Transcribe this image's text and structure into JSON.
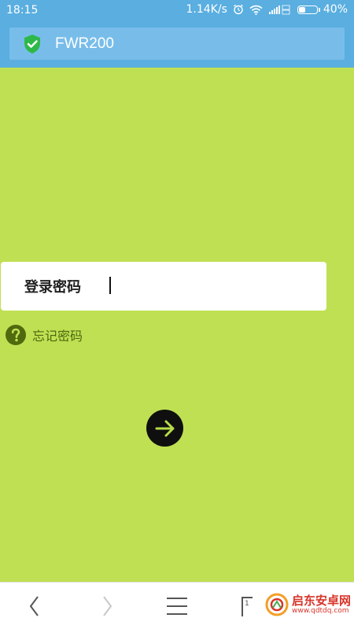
{
  "status_bar": {
    "time": "18:15",
    "network_speed": "1.14K/s",
    "battery_percent": "40%",
    "battery_level": 0.4,
    "icons": [
      "alarm-icon",
      "wifi-icon",
      "signal-icon",
      "battery-icon"
    ]
  },
  "url_bar": {
    "title": "FWR200",
    "secure_icon": "shield-check-icon",
    "secure_color": "#2fb84a"
  },
  "login": {
    "label": "登录密码",
    "password_value": ""
  },
  "forgot": {
    "icon": "question-icon",
    "label": "忘记密码"
  },
  "submit": {
    "icon": "arrow-right-icon",
    "arrow_color": "#b8dc4a"
  },
  "bottom_bar": {
    "tab_count": "1",
    "buttons": [
      "back",
      "forward",
      "menu",
      "tabs",
      "home"
    ]
  },
  "watermark": {
    "title": "启东安卓网",
    "url": "www.qdtdq.com"
  },
  "colors": {
    "background": "#c0e053",
    "header": "#5aaee0",
    "url_bar": "#78bdea"
  }
}
